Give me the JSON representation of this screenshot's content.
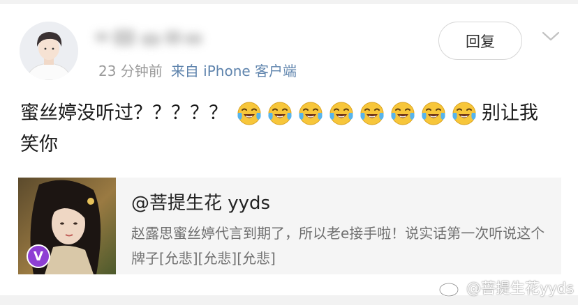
{
  "comment": {
    "time": "23 分钟前",
    "source": "来自 iPhone 客户端",
    "reply_label": "回复",
    "text_line1": "蜜丝婷没听过？？？？？",
    "emoji_name": "laughing-crying-icon",
    "emoji_count": 8,
    "text_after_emojis": "别让我",
    "text_line2": "笑你"
  },
  "quoted_post": {
    "title": "@菩提生花 yyds",
    "text": "赵露思蜜丝婷代言到期了，所以老e接手啦！说实话第一次听说这个牌子[允悲][允悲][允悲]",
    "badge": "V"
  },
  "watermark": "@菩提生花yyds",
  "colors": {
    "source_link": "#5f84ad",
    "badge_purple": "#8e3fd4",
    "card_bg": "#f5f5f5"
  }
}
